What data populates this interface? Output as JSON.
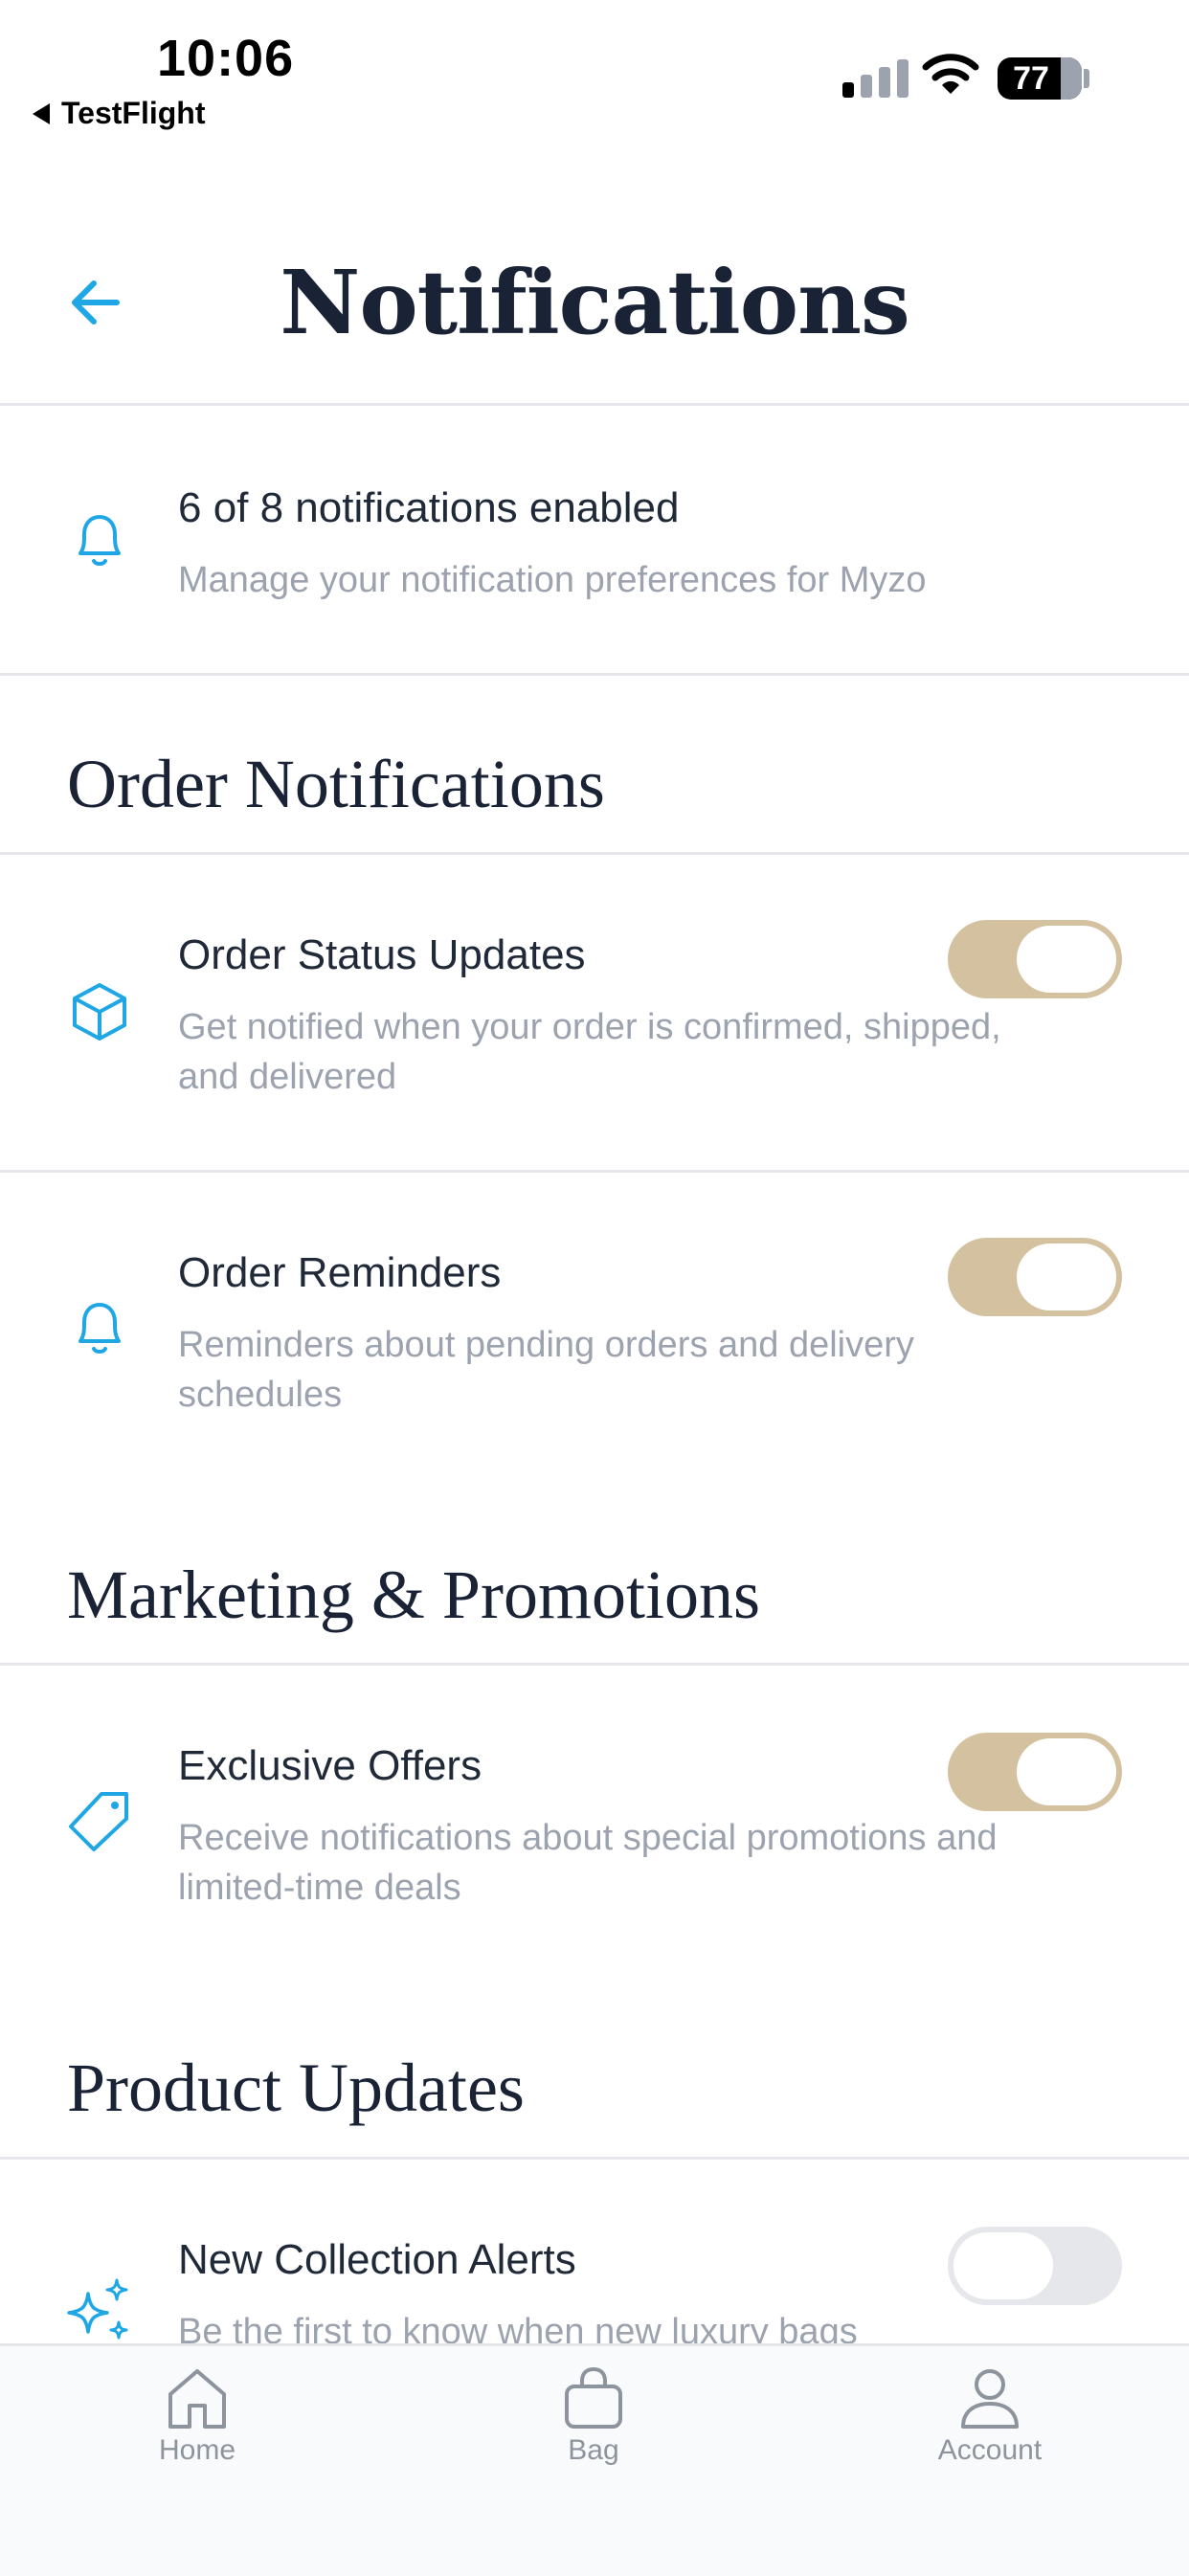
{
  "status_bar": {
    "time": "10:06",
    "back_app": "TestFlight",
    "battery": "77"
  },
  "header": {
    "title": "Notifications"
  },
  "summary": {
    "title": "6 of 8 notifications enabled",
    "description": "Manage your notification preferences for Myzo"
  },
  "sections": [
    {
      "title": "Order Notifications",
      "items": [
        {
          "title": "Order Status Updates",
          "description": "Get notified when your order is confirmed, shipped, and delivered",
          "enabled": true,
          "icon": "box-icon"
        },
        {
          "title": "Order Reminders",
          "description": "Reminders about pending orders and delivery schedules",
          "enabled": true,
          "icon": "bell-icon"
        }
      ]
    },
    {
      "title": "Marketing & Promotions",
      "items": [
        {
          "title": "Exclusive Offers",
          "description": "Receive notifications about special promotions and limited-time deals",
          "enabled": true,
          "icon": "tag-icon"
        }
      ]
    },
    {
      "title": "Product Updates",
      "items": [
        {
          "title": "New Collection Alerts",
          "description": "Be the first to know when new luxury bags",
          "enabled": false,
          "icon": "sparkles-icon"
        }
      ]
    }
  ],
  "tabbar": {
    "home": "Home",
    "bag": "Bag",
    "account": "Account"
  },
  "colors": {
    "accent": "#1ea7e4",
    "toggle_on": "#d4c1a0",
    "toggle_off": "#e5e7eb",
    "title": "#1a2235"
  }
}
